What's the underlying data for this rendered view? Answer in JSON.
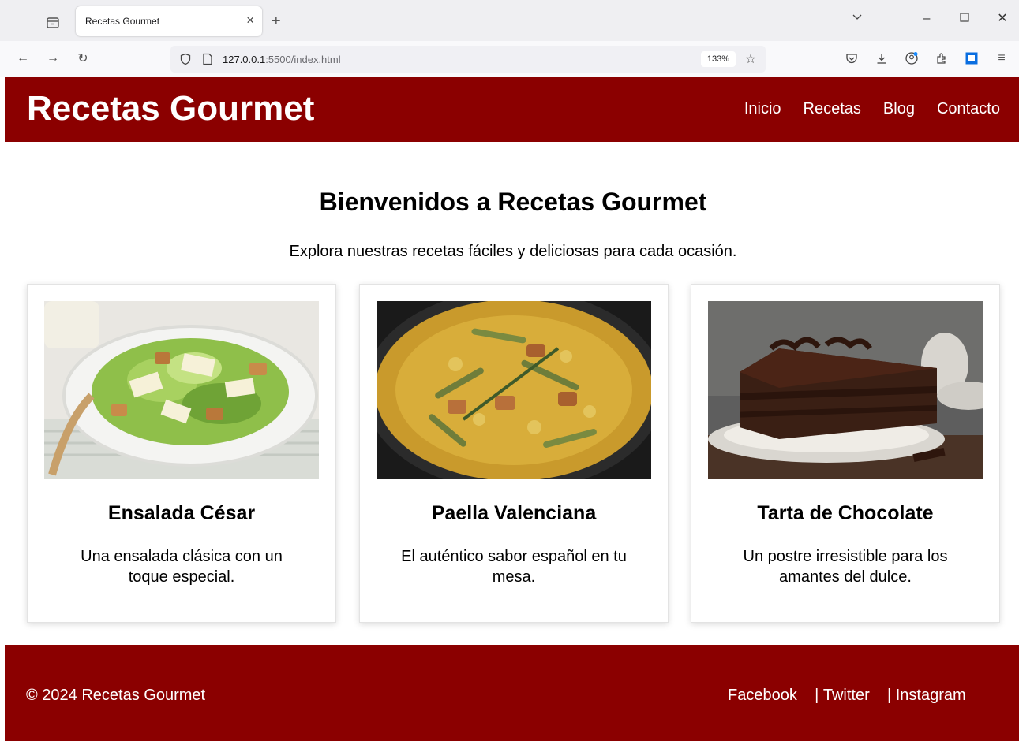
{
  "browser": {
    "tab_title": "Recetas Gourmet",
    "url_host": "127.0.0.1",
    "url_path": ":5500/index.html",
    "zoom": "133%"
  },
  "header": {
    "title": "Recetas Gourmet",
    "nav": [
      "Inicio",
      "Recetas",
      "Blog",
      "Contacto"
    ]
  },
  "hero": {
    "title": "Bienvenidos a Recetas Gourmet",
    "subtitle": "Explora nuestras recetas fáciles y deliciosas para cada ocasión."
  },
  "recipes": [
    {
      "title": "Ensalada César",
      "description": "Una ensalada clásica con un toque especial."
    },
    {
      "title": "Paella Valenciana",
      "description": "El auténtico sabor español en tu mesa."
    },
    {
      "title": "Tarta de Chocolate",
      "description": "Un postre irresistible para los amantes del dulce."
    }
  ],
  "footer": {
    "copyright": "© 2024 Recetas Gourmet",
    "social": [
      "Facebook",
      "Twitter",
      "Instagram"
    ]
  },
  "colors": {
    "brand": "#8b0000",
    "chrome": "#f0f0f4"
  }
}
